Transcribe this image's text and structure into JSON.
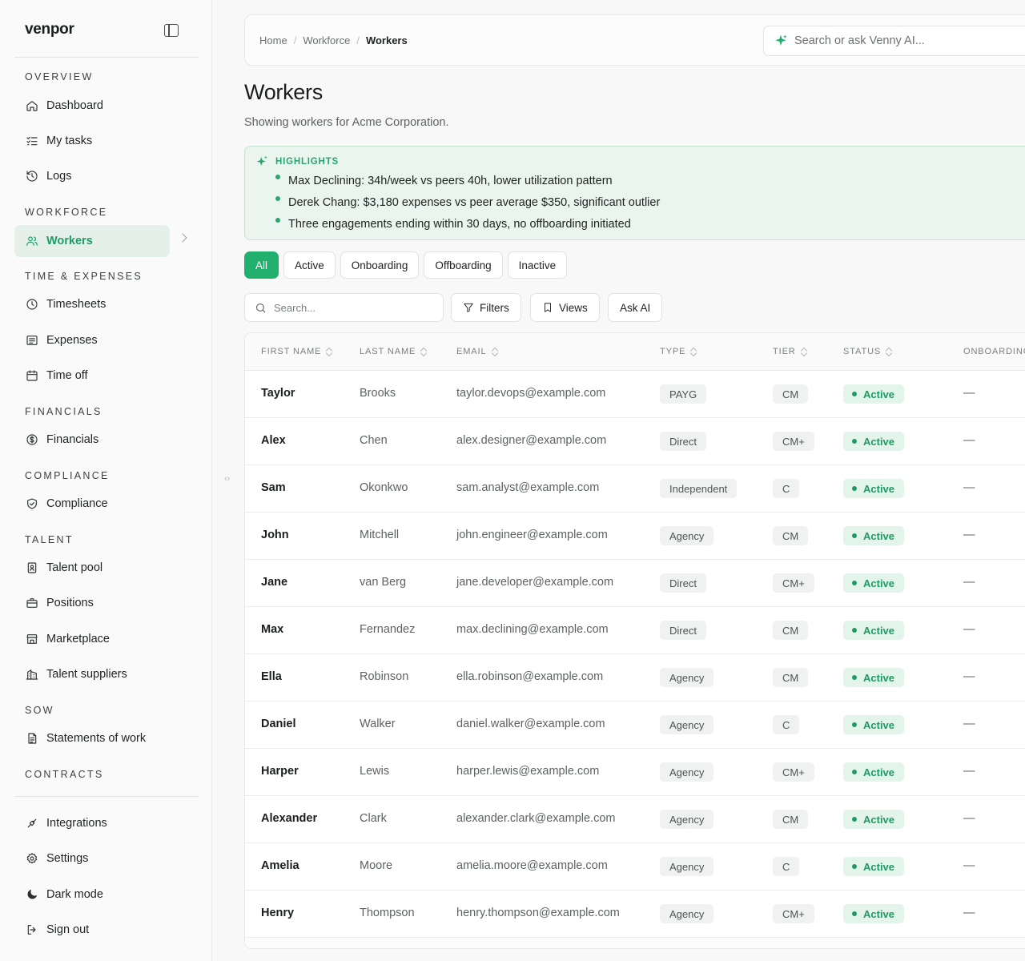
{
  "brand": "venpor",
  "sidebar": {
    "sections": {
      "overview": "OVERVIEW",
      "workforce": "WORKFORCE",
      "time_expenses": "TIME & EXPENSES",
      "financials": "FINANCIALS",
      "compliance": "COMPLIANCE",
      "talent": "TALENT",
      "sow": "SOW",
      "contracts": "CONTRACTS"
    },
    "items": {
      "dashboard": "Dashboard",
      "my_tasks": "My tasks",
      "logs": "Logs",
      "workers": "Workers",
      "timesheets": "Timesheets",
      "expenses": "Expenses",
      "time_off": "Time off",
      "financials": "Financials",
      "compliance": "Compliance",
      "talent_pool": "Talent pool",
      "positions": "Positions",
      "marketplace": "Marketplace",
      "talent_suppliers": "Talent suppliers",
      "statements_of_work": "Statements of work",
      "integrations": "Integrations",
      "settings": "Settings",
      "dark_mode": "Dark mode",
      "sign_out": "Sign out"
    }
  },
  "header": {
    "breadcrumb": [
      "Home",
      "Workforce",
      "Workers"
    ],
    "search_placeholder": "Search or ask Venny AI..."
  },
  "page": {
    "title": "Workers",
    "subtitle": "Showing workers for Acme Corporation."
  },
  "highlights": {
    "label": "HIGHLIGHTS",
    "items": [
      "Max Declining: 34h/week vs peers 40h, lower utilization pattern",
      "Derek Chang: $3,180 expenses vs peer average $350, significant outlier",
      "Three engagements ending within 30 days, no offboarding initiated"
    ]
  },
  "tabs": [
    "All",
    "Active",
    "Onboarding",
    "Offboarding",
    "Inactive"
  ],
  "toolbar": {
    "search_placeholder": "Search...",
    "filters": "Filters",
    "views": "Views",
    "ask_ai": "Ask AI"
  },
  "table": {
    "columns": [
      "FIRST NAME",
      "LAST NAME",
      "EMAIL",
      "TYPE",
      "TIER",
      "STATUS",
      "ONBOARDING"
    ],
    "rows": [
      {
        "first": "Taylor",
        "last": "Brooks",
        "email": "taylor.devops@example.com",
        "type": "PAYG",
        "tier": "CM",
        "status": "Active",
        "onboarding": "—"
      },
      {
        "first": "Alex",
        "last": "Chen",
        "email": "alex.designer@example.com",
        "type": "Direct",
        "tier": "CM+",
        "status": "Active",
        "onboarding": "—"
      },
      {
        "first": "Sam",
        "last": "Okonkwo",
        "email": "sam.analyst@example.com",
        "type": "Independent",
        "tier": "C",
        "status": "Active",
        "onboarding": "—"
      },
      {
        "first": "John",
        "last": "Mitchell",
        "email": "john.engineer@example.com",
        "type": "Agency",
        "tier": "CM",
        "status": "Active",
        "onboarding": "—"
      },
      {
        "first": "Jane",
        "last": "van Berg",
        "email": "jane.developer@example.com",
        "type": "Direct",
        "tier": "CM+",
        "status": "Active",
        "onboarding": "—"
      },
      {
        "first": "Max",
        "last": "Fernandez",
        "email": "max.declining@example.com",
        "type": "Direct",
        "tier": "CM",
        "status": "Active",
        "onboarding": "—"
      },
      {
        "first": "Ella",
        "last": "Robinson",
        "email": "ella.robinson@example.com",
        "type": "Agency",
        "tier": "CM",
        "status": "Active",
        "onboarding": "—"
      },
      {
        "first": "Daniel",
        "last": "Walker",
        "email": "daniel.walker@example.com",
        "type": "Agency",
        "tier": "C",
        "status": "Active",
        "onboarding": "—"
      },
      {
        "first": "Harper",
        "last": "Lewis",
        "email": "harper.lewis@example.com",
        "type": "Agency",
        "tier": "CM+",
        "status": "Active",
        "onboarding": "—"
      },
      {
        "first": "Alexander",
        "last": "Clark",
        "email": "alexander.clark@example.com",
        "type": "Agency",
        "tier": "CM",
        "status": "Active",
        "onboarding": "—"
      },
      {
        "first": "Amelia",
        "last": "Moore",
        "email": "amelia.moore@example.com",
        "type": "Agency",
        "tier": "C",
        "status": "Active",
        "onboarding": "—"
      },
      {
        "first": "Henry",
        "last": "Thompson",
        "email": "henry.thompson@example.com",
        "type": "Agency",
        "tier": "CM+",
        "status": "Active",
        "onboarding": "—"
      }
    ]
  },
  "colors": {
    "accent": "#22b06f",
    "accent_text": "#1e9b62",
    "highlight_bg": "#eaf5ef",
    "status_bg": "#e3f4ea"
  }
}
